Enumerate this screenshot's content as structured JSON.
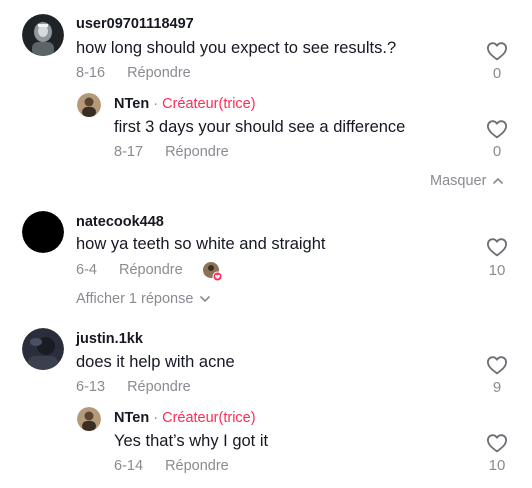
{
  "reply_label": "Répondre",
  "creator_label": "Créateur(trice)",
  "separator": "·",
  "colors": {
    "accent": "#FE2C55",
    "muted": "#8a8b91",
    "text": "#161823"
  },
  "threads": [
    {
      "username": "user09701118497",
      "text": "how long should you expect to see results.?",
      "date": "8-16",
      "likes": "0",
      "replies": [
        {
          "username": "NTen",
          "text": "first 3 days your should see a difference",
          "date": "8-17",
          "likes": "0"
        }
      ],
      "toggle_label": "Masquer"
    },
    {
      "username": "natecook448",
      "text": "how ya teeth so white and straight",
      "date": "6-4",
      "likes": "10",
      "creator_liked": true,
      "toggle_label": "Afficher 1 réponse"
    },
    {
      "username": "justin.1kk",
      "text": "does it help with acne",
      "date": "6-13",
      "likes": "9",
      "replies": [
        {
          "username": "NTen",
          "text": "Yes that’s why I got it",
          "date": "6-14",
          "likes": "10"
        }
      ]
    }
  ]
}
